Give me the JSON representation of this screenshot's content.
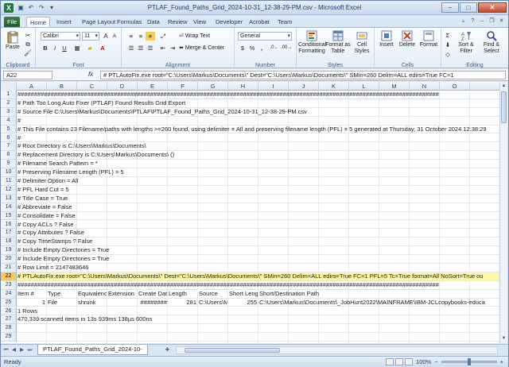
{
  "window": {
    "title": "PTLAF_Found_Paths_Grid_2024-10-31_12-38-29-PM.csv - Microsoft Excel",
    "app_icon_letter": "X",
    "buttons": {
      "minimize": "–",
      "maximize": "□",
      "close": "✕"
    }
  },
  "ribbon_tabs": [
    "File",
    "Home",
    "Insert",
    "Page Layout",
    "Formulas",
    "Data",
    "Review",
    "View",
    "Developer",
    "Acrobat",
    "Team"
  ],
  "ribbon": {
    "clipboard": {
      "label": "Clipboard",
      "paste": "Paste"
    },
    "font": {
      "label": "Font",
      "font_name": "Calibri",
      "font_size": "11",
      "bold": "B",
      "italic": "I",
      "underline": "U",
      "grow": "A",
      "shrink": "A"
    },
    "alignment": {
      "label": "Alignment",
      "wrap_text": "Wrap Text",
      "merge_center": "Merge & Center"
    },
    "number": {
      "label": "Number",
      "format": "General",
      "currency": "$",
      "percent": "%",
      "comma": ","
    },
    "styles": {
      "label": "Styles",
      "conditional": "Conditional",
      "conditional2": "Formatting",
      "format_as": "Format as",
      "format_as2": "Table",
      "cell": "Cell",
      "cell2": "Styles"
    },
    "cells": {
      "label": "Cells",
      "insert": "Insert",
      "delete": "Delete",
      "format": "Format"
    },
    "editing": {
      "label": "Editing",
      "sort": "Sort &",
      "sort2": "Filter",
      "find": "Find &",
      "find2": "Select"
    }
  },
  "formula_bar": {
    "name_box": "A22",
    "fx": "fx",
    "content": "# PTLAutoFix.exe root=\"C:\\Users\\Markus\\Documents\\\" Dest=\"C:\\Users\\Markus\\Documents\\\" SMin=260 Delim=ALL edirs=True FC=1"
  },
  "columns": [
    "A",
    "B",
    "C",
    "D",
    "E",
    "F",
    "G",
    "H",
    "I",
    "J",
    "K",
    "L",
    "M",
    "N",
    "O"
  ],
  "rows": [
    {
      "num": "1",
      "cells": [
        "###############################################################################################################################"
      ]
    },
    {
      "num": "2",
      "cells": [
        "# Path Too Long Auto Fixer (PTLAF) Found Results Grid Export"
      ]
    },
    {
      "num": "3",
      "cells": [
        "# Source File C:\\Users\\Markus\\Documents\\PTLAF\\PTLAF_Found_Paths_Grid_2024-10-31_12-38-29-PM.csv"
      ]
    },
    {
      "num": "4",
      "cells": [
        "#"
      ]
    },
    {
      "num": "5",
      "cells": [
        "# This File contains 23 Filename/paths with lengths >=260 found, using delimiter = All and preserving filename length (PFL) = 5 generated at Thursday, 31 October 2024 12:38:29"
      ]
    },
    {
      "num": "6",
      "cells": [
        "#"
      ]
    },
    {
      "num": "7",
      "cells": [
        "# Root Directory is C:\\Users\\Markus\\Documents\\"
      ]
    },
    {
      "num": "8",
      "cells": [
        "# Replacement Directory is C:\\Users\\Markus\\Documents\\ ()"
      ]
    },
    {
      "num": "9",
      "cells": [
        "# Filename Search Pattern = *"
      ]
    },
    {
      "num": "10",
      "cells": [
        "# Preserving Filename Length (PFL) = 5"
      ]
    },
    {
      "num": "11",
      "cells": [
        "# Delimiter Option = All"
      ]
    },
    {
      "num": "12",
      "cells": [
        "# PFL Hard Cut = 5"
      ]
    },
    {
      "num": "13",
      "cells": [
        "# Title Case = True"
      ]
    },
    {
      "num": "14",
      "cells": [
        "# Abbreviate = False"
      ]
    },
    {
      "num": "15",
      "cells": [
        "# Consolidate = False"
      ]
    },
    {
      "num": "16",
      "cells": [
        "# Copy ACLs ? False"
      ]
    },
    {
      "num": "17",
      "cells": [
        "# Copy Attributes ? False"
      ]
    },
    {
      "num": "18",
      "cells": [
        "# Copy TimeStamps ? False"
      ]
    },
    {
      "num": "19",
      "cells": [
        "# Include Empty Directories = True"
      ]
    },
    {
      "num": "20",
      "cells": [
        "# Include Empty Directories = True"
      ]
    },
    {
      "num": "21",
      "cells": [
        "# Row Limit = 2147483646"
      ]
    },
    {
      "num": "22",
      "selected": true,
      "cells": [
        "# PTLAutoFix.exe root=\"C:\\Users\\Markus\\Documents\\\" Dest=\"C:\\Users\\Markus\\Documents\\\" SMin=260 Delim=ALL edirs=True FC=1 PFL=5 Tc=True format=All NoSort=True ou"
      ]
    },
    {
      "num": "23",
      "cells": [
        "###############################################################################################################################"
      ]
    },
    {
      "num": "24",
      "cells": [
        "Item #",
        "Type",
        "Equivalenc",
        "Extension",
        "Create Dat",
        "Length",
        "Source",
        "Short Leng",
        "Short/Destination Path"
      ]
    },
    {
      "num": "25",
      "cells": [
        "1",
        "File",
        "shrunk",
        "",
        "########",
        "281",
        "C:\\Users\\M",
        "255",
        "C:\\Users\\Markus\\Documents\\_JobHunt2022\\MAINFRAME\\IBM-JCLcopybooks-educa"
      ]
    },
    {
      "num": "26",
      "cells": [
        "1 Rows"
      ]
    },
    {
      "num": "27",
      "cells": [
        "470,339 scanned items in 13s 939ms 138µs 600ns"
      ]
    },
    {
      "num": "28",
      "cells": []
    },
    {
      "num": "29",
      "cells": []
    }
  ],
  "sheet_tab": "PTLAF_Found_Paths_Grid_2024-10-",
  "status": {
    "text": "Ready",
    "zoom": "100%"
  }
}
